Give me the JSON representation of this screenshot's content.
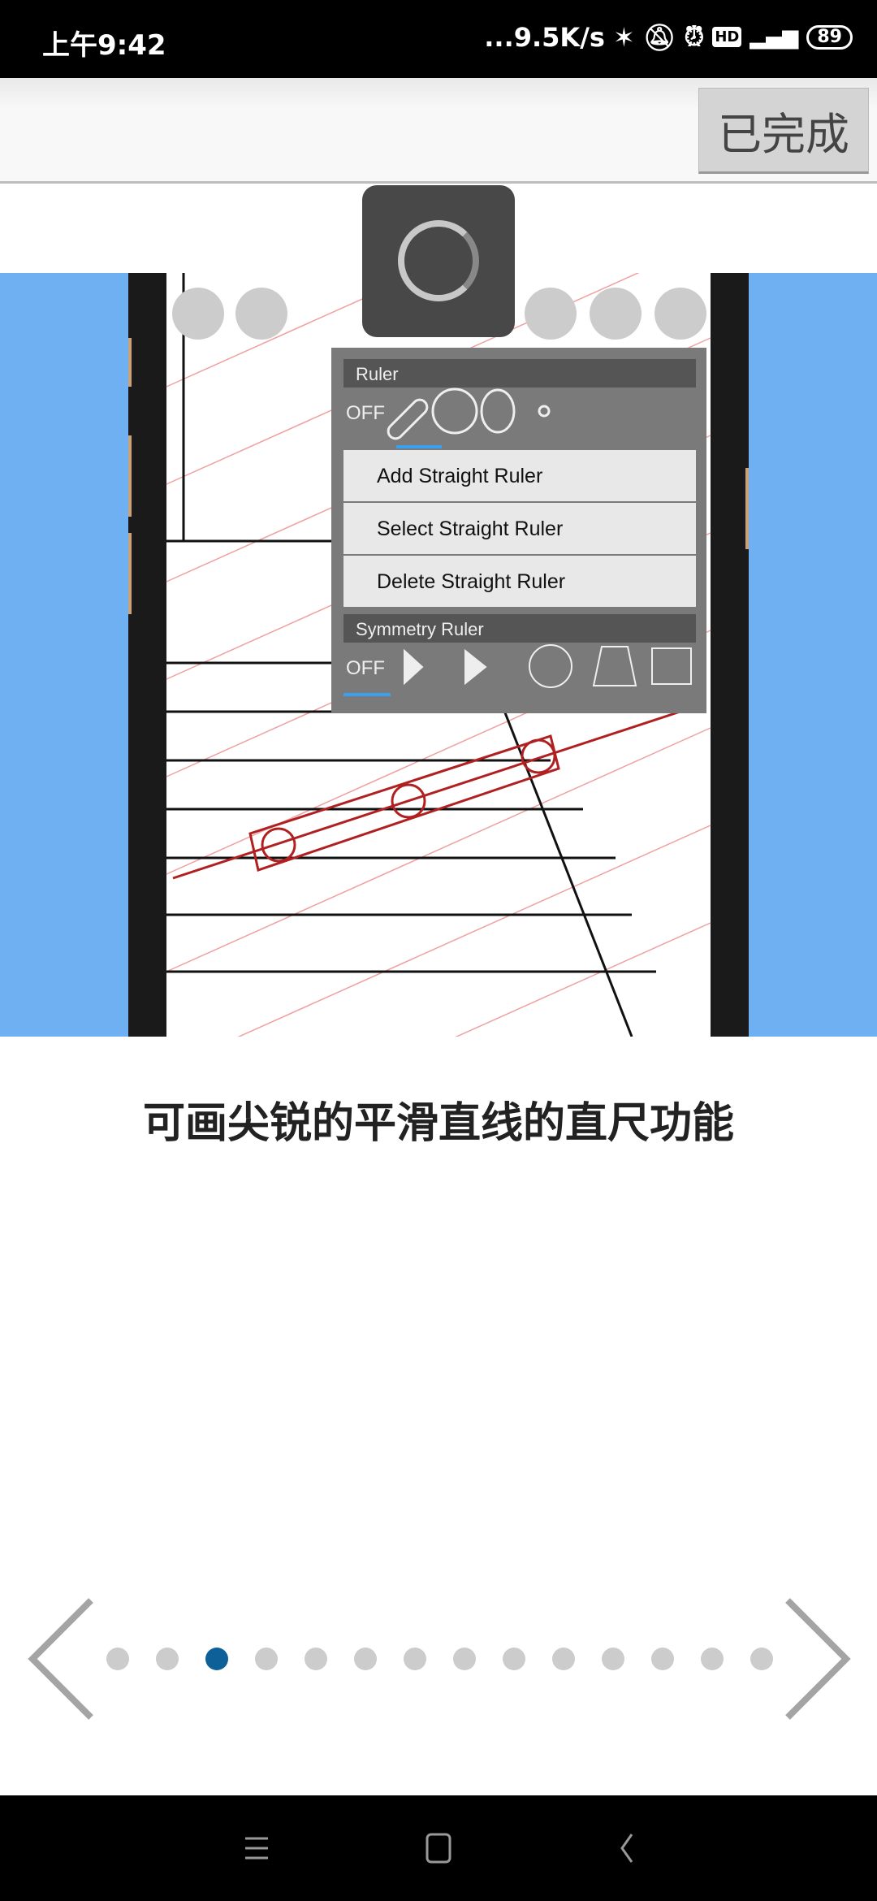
{
  "status_bar": {
    "time": "上午9:42",
    "network_speed": "...9.5K/s",
    "icons": [
      "bluetooth-icon",
      "mute-bell-icon",
      "alarm-icon",
      "hd-icon",
      "signal-4g-icon"
    ],
    "battery": "89"
  },
  "toolbar": {
    "done_label": "已完成"
  },
  "screenshot": {
    "ruler_header": "Ruler",
    "off_label": "OFF",
    "menu_items": [
      "Add Straight Ruler",
      "Select Straight Ruler",
      "Delete Straight Ruler"
    ],
    "symmetry_header": "Symmetry Ruler",
    "symmetry_off_label": "OFF"
  },
  "caption": "可画尖锐的平滑直线的直尺功能",
  "pager": {
    "total": 14,
    "active_index": 2,
    "active_color": "#0e6198",
    "inactive_color": "#cccccc"
  },
  "colors": {
    "band": "#6eb0f2"
  }
}
